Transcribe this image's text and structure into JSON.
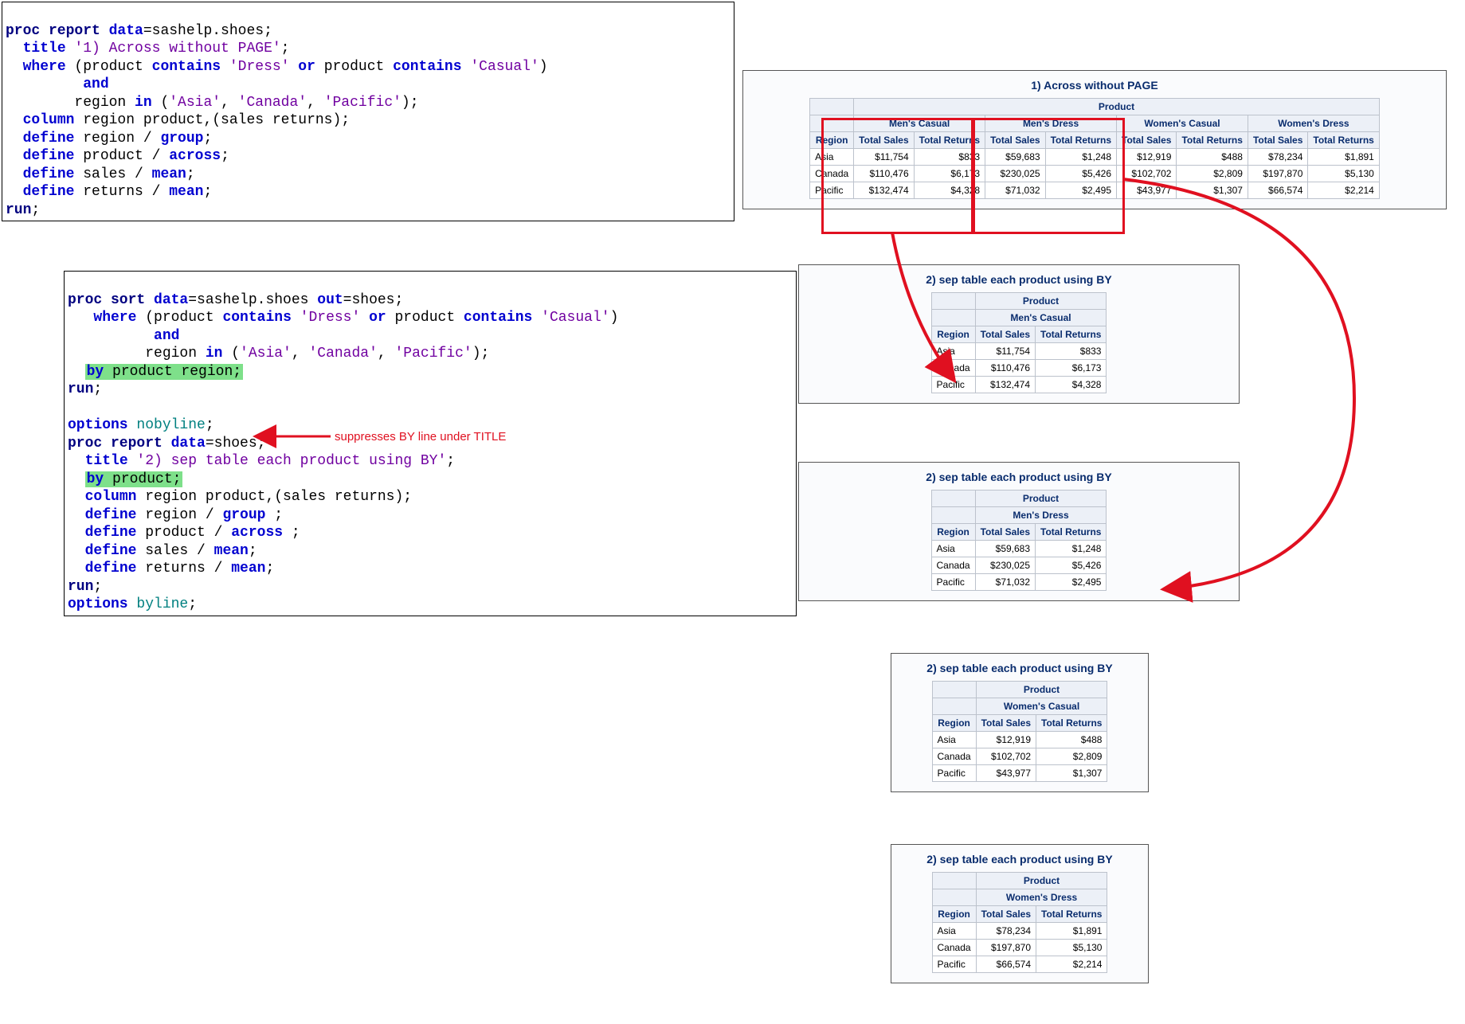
{
  "code1": {
    "l1a": "proc report",
    "l1b": " data",
    "l1c": "=sashelp.shoes;",
    "l2a": "title",
    "l2b": " '1) Across without PAGE'",
    "l2c": ";",
    "l3a": "where",
    "l3b": " (product ",
    "l3c": "contains",
    "l3d": " 'Dress'",
    "l3e": " or",
    "l3f": " product ",
    "l3g": "contains",
    "l3h": " 'Casual'",
    "l3i": ")",
    "l4a": "and",
    "l5a": "        region ",
    "l5b": "in",
    "l5c": " (",
    "l5d": "'Asia'",
    "l5e": ", ",
    "l5f": "'Canada'",
    "l5g": ", ",
    "l5h": "'Pacific'",
    "l5i": ");",
    "l6a": "column",
    "l6b": " region product,(sales returns);",
    "l7a": "define",
    "l7b": " region / ",
    "l7c": "group",
    "l7d": ";",
    "l8a": "define",
    "l8b": " product / ",
    "l8c": "across",
    "l8d": ";",
    "l9a": "define",
    "l9b": " sales / ",
    "l9c": "mean",
    "l9d": ";",
    "l10a": "define",
    "l10b": " returns / ",
    "l10c": "mean",
    "l10d": ";",
    "l11": "run",
    "l11b": ";"
  },
  "code2": {
    "s1a": "proc sort",
    "s1b": " data",
    "s1c": "=sashelp.shoes ",
    "s1d": "out",
    "s1e": "=shoes;",
    "s2a": "where",
    "s2b": " (product ",
    "s2c": "contains",
    "s2d": " 'Dress'",
    "s2e": " or",
    "s2f": " product ",
    "s2g": "contains",
    "s2h": " 'Casual'",
    "s2i": ")",
    "s3a": "and",
    "s4a": "         region ",
    "s4b": "in",
    "s4c": " (",
    "s4d": "'Asia'",
    "s4e": ", ",
    "s4f": "'Canada'",
    "s4g": ", ",
    "s4h": "'Pacific'",
    "s4i": ");",
    "s5a": "by",
    "s5b": " product region;",
    "s6": "run",
    "s6b": ";",
    "opt1a": "options",
    "opt1b": " nobyline",
    "opt1c": ";",
    "r1a": "proc report",
    "r1b": " data",
    "r1c": "=shoes;",
    "r2a": "title",
    "r2b": " '2) sep table each product using BY'",
    "r2c": ";",
    "r3a": "by",
    "r3b": " product;",
    "r4a": "column",
    "r4b": " region product,(sales returns);",
    "r5a": "define",
    "r5b": " region / ",
    "r5c": "group",
    "r5d": " ;",
    "r6a": "define",
    "r6b": " product / ",
    "r6c": "across",
    "r6d": " ;",
    "r7a": "define",
    "r7b": " sales / ",
    "r7c": "mean",
    "r7d": ";",
    "r8a": "define",
    "r8b": " returns / ",
    "r8c": "mean",
    "r8d": ";",
    "r9": "run",
    "r9b": ";",
    "opt2a": "options",
    "opt2b": " byline",
    "opt2c": ";"
  },
  "annot": {
    "suppress": "suppresses BY line under TITLE"
  },
  "titles": {
    "t1": "1) Across without PAGE",
    "t2": "2) sep table each product using BY"
  },
  "hdr": {
    "product": "Product",
    "region": "Region",
    "tsales": "Total Sales",
    "treturns": "Total Returns",
    "mc": "Men's Casual",
    "md": "Men's Dress",
    "wc": "Women's Casual",
    "wd": "Women's Dress"
  },
  "rows": {
    "asia": "Asia",
    "canada": "Canada",
    "pacific": "Pacific"
  },
  "data": {
    "mc": {
      "asia_s": "$11,754",
      "asia_r": "$833",
      "can_s": "$110,476",
      "can_r": "$6,173",
      "pac_s": "$132,474",
      "pac_r": "$4,328"
    },
    "md": {
      "asia_s": "$59,683",
      "asia_r": "$1,248",
      "can_s": "$230,025",
      "can_r": "$5,426",
      "pac_s": "$71,032",
      "pac_r": "$2,495"
    },
    "wc": {
      "asia_s": "$12,919",
      "asia_r": "$488",
      "can_s": "$102,702",
      "can_r": "$2,809",
      "pac_s": "$43,977",
      "pac_r": "$1,307"
    },
    "wd": {
      "asia_s": "$78,234",
      "asia_r": "$1,891",
      "can_s": "$197,870",
      "can_r": "$5,130",
      "pac_s": "$66,574",
      "pac_r": "$2,214"
    }
  },
  "chart_data": [
    {
      "type": "table",
      "title": "1) Across without PAGE",
      "columns_group": "Product",
      "products": [
        "Men's Casual",
        "Men's Dress",
        "Women's Casual",
        "Women's Dress"
      ],
      "measures": [
        "Total Sales",
        "Total Returns"
      ],
      "rows": [
        {
          "Region": "Asia",
          "Men's Casual": {
            "Total Sales": 11754,
            "Total Returns": 833
          },
          "Men's Dress": {
            "Total Sales": 59683,
            "Total Returns": 1248
          },
          "Women's Casual": {
            "Total Sales": 12919,
            "Total Returns": 488
          },
          "Women's Dress": {
            "Total Sales": 78234,
            "Total Returns": 1891
          }
        },
        {
          "Region": "Canada",
          "Men's Casual": {
            "Total Sales": 110476,
            "Total Returns": 6173
          },
          "Men's Dress": {
            "Total Sales": 230025,
            "Total Returns": 5426
          },
          "Women's Casual": {
            "Total Sales": 102702,
            "Total Returns": 2809
          },
          "Women's Dress": {
            "Total Sales": 197870,
            "Total Returns": 5130
          }
        },
        {
          "Region": "Pacific",
          "Men's Casual": {
            "Total Sales": 132474,
            "Total Returns": 4328
          },
          "Men's Dress": {
            "Total Sales": 71032,
            "Total Returns": 2495
          },
          "Women's Casual": {
            "Total Sales": 43977,
            "Total Returns": 1307
          },
          "Women's Dress": {
            "Total Sales": 66574,
            "Total Returns": 2214
          }
        }
      ]
    },
    {
      "type": "table",
      "title": "2) sep table each product using BY — Men's Casual",
      "rows": [
        {
          "Region": "Asia",
          "Total Sales": 11754,
          "Total Returns": 833
        },
        {
          "Region": "Canada",
          "Total Sales": 110476,
          "Total Returns": 6173
        },
        {
          "Region": "Pacific",
          "Total Sales": 132474,
          "Total Returns": 4328
        }
      ]
    },
    {
      "type": "table",
      "title": "2) sep table each product using BY — Men's Dress",
      "rows": [
        {
          "Region": "Asia",
          "Total Sales": 59683,
          "Total Returns": 1248
        },
        {
          "Region": "Canada",
          "Total Sales": 230025,
          "Total Returns": 5426
        },
        {
          "Region": "Pacific",
          "Total Sales": 71032,
          "Total Returns": 2495
        }
      ]
    },
    {
      "type": "table",
      "title": "2) sep table each product using BY — Women's Casual",
      "rows": [
        {
          "Region": "Asia",
          "Total Sales": 12919,
          "Total Returns": 488
        },
        {
          "Region": "Canada",
          "Total Sales": 102702,
          "Total Returns": 2809
        },
        {
          "Region": "Pacific",
          "Total Sales": 43977,
          "Total Returns": 1307
        }
      ]
    },
    {
      "type": "table",
      "title": "2) sep table each product using BY — Women's Dress",
      "rows": [
        {
          "Region": "Asia",
          "Total Sales": 78234,
          "Total Returns": 1891
        },
        {
          "Region": "Canada",
          "Total Sales": 197870,
          "Total Returns": 5130
        },
        {
          "Region": "Pacific",
          "Total Sales": 66574,
          "Total Returns": 2214
        }
      ]
    }
  ]
}
